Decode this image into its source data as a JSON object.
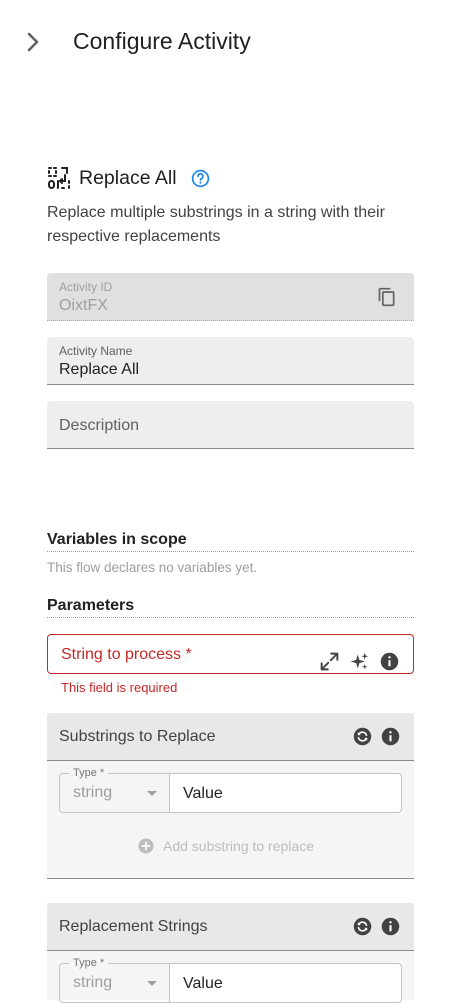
{
  "header": {
    "title": "Configure Activity",
    "collapse_icon": "chevron-right-icon"
  },
  "activity": {
    "icon": "replace-all-icon",
    "title": "Replace All",
    "help_icon": "help-circle-icon",
    "description": "Replace multiple substrings in a string with their respective replacements"
  },
  "fields": {
    "activity_id": {
      "label": "Activity ID",
      "value": "OixtFX",
      "copy_icon": "copy-icon"
    },
    "activity_name": {
      "label": "Activity Name",
      "value": "Replace All"
    },
    "description": {
      "placeholder": "Description"
    }
  },
  "variables": {
    "heading": "Variables in scope",
    "note": "This flow declares no variables yet."
  },
  "parameters": {
    "heading": "Parameters",
    "string_to_process": {
      "label": "String to process *",
      "error": "This field is required",
      "icons": [
        "expand-icon",
        "sparkle-icon",
        "info-icon"
      ]
    },
    "substrings": {
      "title": "Substrings to Replace",
      "type_label": "Type *",
      "type_value": "string",
      "value_text": "Value",
      "add_label": "Add substring to replace"
    },
    "replacements": {
      "title": "Replacement Strings",
      "type_label": "Type *",
      "type_value": "string",
      "value_text": "Value"
    }
  },
  "colors": {
    "error": "#c62828",
    "help": "#1e88e5",
    "field_bg": "#eeeeee"
  }
}
